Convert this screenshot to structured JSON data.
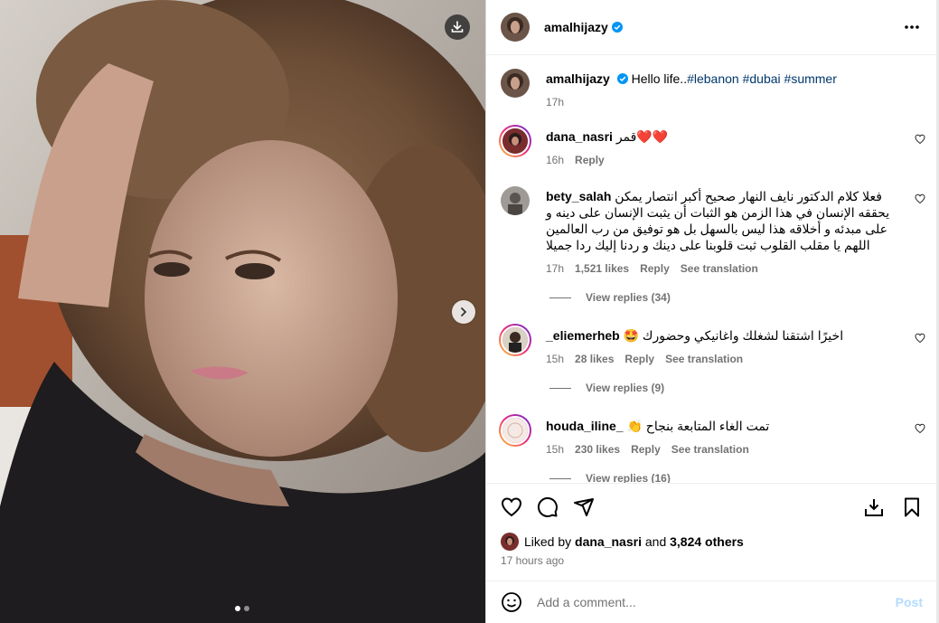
{
  "post": {
    "author": "amalhijazy",
    "caption_text": "Hello life..",
    "hashtags": [
      "#lebanon",
      "#dubai",
      "#summer"
    ],
    "caption_time": "17h"
  },
  "comments": [
    {
      "username": "dana_nasri",
      "text": "قمر❤️❤️",
      "time": "16h",
      "likes": "",
      "reply": "Reply",
      "translate": ""
    },
    {
      "username": "bety_salah",
      "text": "فعلا كلام الدكتور نايف النهار صحيح أكبر انتصار يمكن يحققه الإنسان في هذا الزمن هو الثبات أن يثبت الإنسان على دينه و على مبدئه و أخلاقه هذا ليس بالسهل بل هو توفيق من رب العالمين اللهم يا مقلب القلوب ثبت قلوبنا على دينك و ردنا إليك ردا جميلا",
      "time": "17h",
      "likes": "1,521 likes",
      "reply": "Reply",
      "translate": "See translation",
      "view_replies": "View replies (34)"
    },
    {
      "username": "_eliemerheb",
      "text": "اخيرًا اشتقنا لشغلك واغانيكي وحضورك 🤩",
      "time": "15h",
      "likes": "28 likes",
      "reply": "Reply",
      "translate": "See translation",
      "view_replies": "View replies (9)"
    },
    {
      "username": "houda_iline_",
      "text": "تمت الغاء المتابعة بنجاح 👏",
      "time": "15h",
      "likes": "230 likes",
      "reply": "Reply",
      "translate": "See translation",
      "view_replies": "View replies (16)"
    }
  ],
  "likes": {
    "prefix": "Liked by",
    "user": "dana_nasri",
    "and": "and",
    "others": "3,824 others"
  },
  "time_ago": "17 hours ago",
  "add_comment": {
    "placeholder": "Add a comment...",
    "post_label": "Post"
  },
  "icons": {
    "download": "download-icon",
    "next": "chevron-right-icon",
    "more": "more-options-icon",
    "verified": "verified-badge-icon",
    "heart": "heart-icon",
    "comment": "comment-icon",
    "share": "share-icon",
    "save": "bookmark-icon",
    "emoji": "emoji-icon"
  },
  "colors": {
    "verified": "#0095f6",
    "link": "#00376b",
    "muted": "#737373",
    "post_disabled": "#b3dbff"
  }
}
